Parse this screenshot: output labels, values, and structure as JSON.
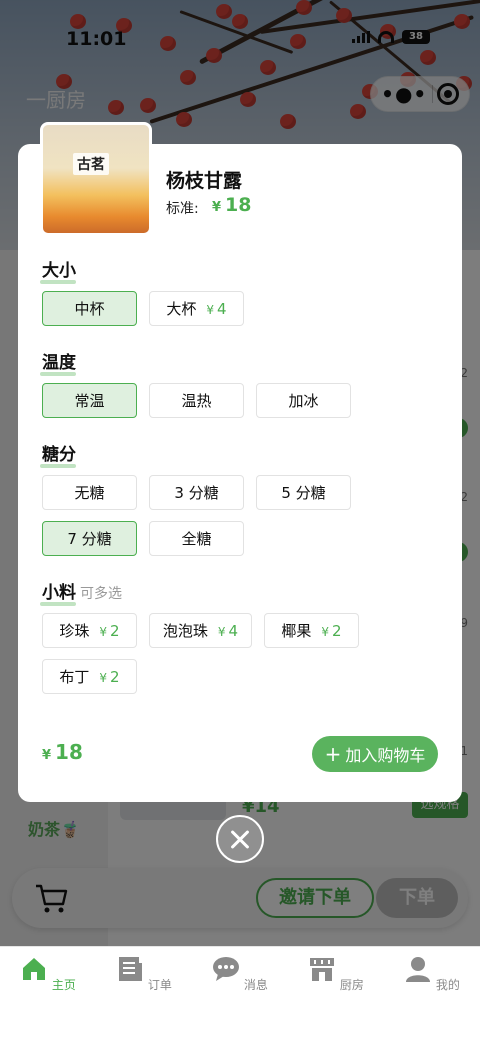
{
  "status": {
    "time": "11:01",
    "battery": "38"
  },
  "header": {
    "title": "一厨房"
  },
  "sidebar": {
    "active_category": "奶茶🧋"
  },
  "background_item": {
    "price": "¥14",
    "spec_button": "选规格"
  },
  "background_numbers": [
    "2",
    "2",
    "9",
    "1"
  ],
  "product": {
    "name": "杨枝甘露",
    "image_label": "古茗",
    "standard_label": "标准:",
    "currency": "¥",
    "price": "18"
  },
  "sections": {
    "size": {
      "title": "大小",
      "options": [
        {
          "label": "中杯",
          "selected": true
        },
        {
          "label": "大杯",
          "extra": "4"
        }
      ]
    },
    "temperature": {
      "title": "温度",
      "options": [
        {
          "label": "常温",
          "selected": true
        },
        {
          "label": "温热"
        },
        {
          "label": "加冰"
        }
      ]
    },
    "sugar": {
      "title": "糖分",
      "options": [
        {
          "label": "无糖"
        },
        {
          "label": "3 分糖"
        },
        {
          "label": "5 分糖"
        },
        {
          "label": "7 分糖",
          "selected": true
        },
        {
          "label": "全糖"
        }
      ]
    },
    "toppings": {
      "title": "小料",
      "hint": "可多选",
      "options": [
        {
          "label": "珍珠",
          "extra": "2"
        },
        {
          "label": "泡泡珠",
          "extra": "4"
        },
        {
          "label": "椰果",
          "extra": "2"
        },
        {
          "label": "布丁",
          "extra": "2"
        }
      ]
    }
  },
  "footer": {
    "currency": "¥",
    "total": "18",
    "add_to_cart": "加入购物车"
  },
  "cart_bar": {
    "invite": "邀请下单",
    "order": "下单"
  },
  "tabs": [
    {
      "label": "主页",
      "icon": "home-icon",
      "active": true
    },
    {
      "label": "订单",
      "icon": "order-icon"
    },
    {
      "label": "消息",
      "icon": "message-icon"
    },
    {
      "label": "厨房",
      "icon": "kitchen-icon"
    },
    {
      "label": "我的",
      "icon": "profile-icon"
    }
  ],
  "colors": {
    "accent": "#4caf50",
    "selected_bg": "#dff0df"
  }
}
